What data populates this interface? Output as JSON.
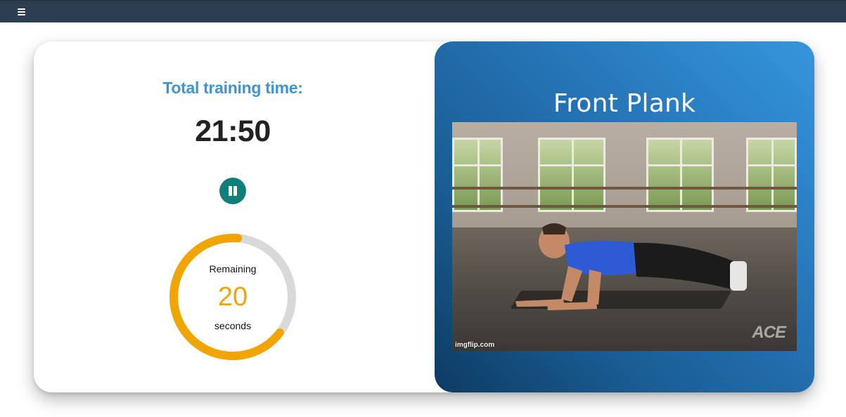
{
  "topbar": {
    "menu_icon": "hamburger-menu-icon"
  },
  "workout": {
    "total_label": "Total training time:",
    "total_time": "21:50",
    "pause_icon": "pause-icon"
  },
  "timer": {
    "remaining_label": "Remaining",
    "remaining_value": "20",
    "unit_label": "seconds",
    "progress_fraction": 0.66,
    "track_color": "#d9d9d9",
    "progress_color": "#f0a500"
  },
  "exercise": {
    "name": "Front Plank",
    "image_watermark": "imgflip.com",
    "image_logo": "ACE"
  },
  "colors": {
    "topbar": "#2c3e50",
    "accent_blue": "#3b95d6",
    "pause_button": "#0e8079"
  }
}
